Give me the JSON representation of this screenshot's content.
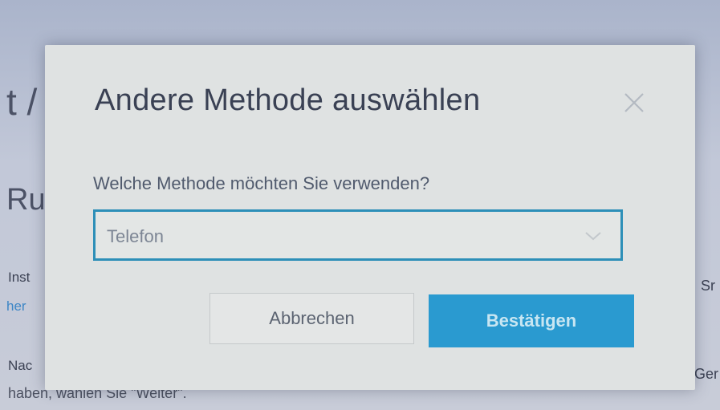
{
  "background": {
    "title_fragment": "t /",
    "section_fragment": "Ru",
    "line1_fragment": "Inst",
    "link_fragment": "her",
    "line2_fragment": "Nac",
    "line3_text": "haben, wählen Sie \"Weiter\".",
    "right_fragment1": "Sr",
    "right_fragment2": "Ger"
  },
  "dialog": {
    "title": "Andere Methode auswählen",
    "question": "Welche Methode möchten Sie verwenden?",
    "method_select": {
      "selected": "Telefon"
    },
    "cancel_label": "Abbrechen",
    "confirm_label": "Bestätigen"
  },
  "icons": {
    "close": "close-icon",
    "dropdown": "chevron-down-icon"
  },
  "colors": {
    "accent": "#2a9ad0",
    "select_border": "#2d8fb8",
    "link": "#3d86c6"
  }
}
